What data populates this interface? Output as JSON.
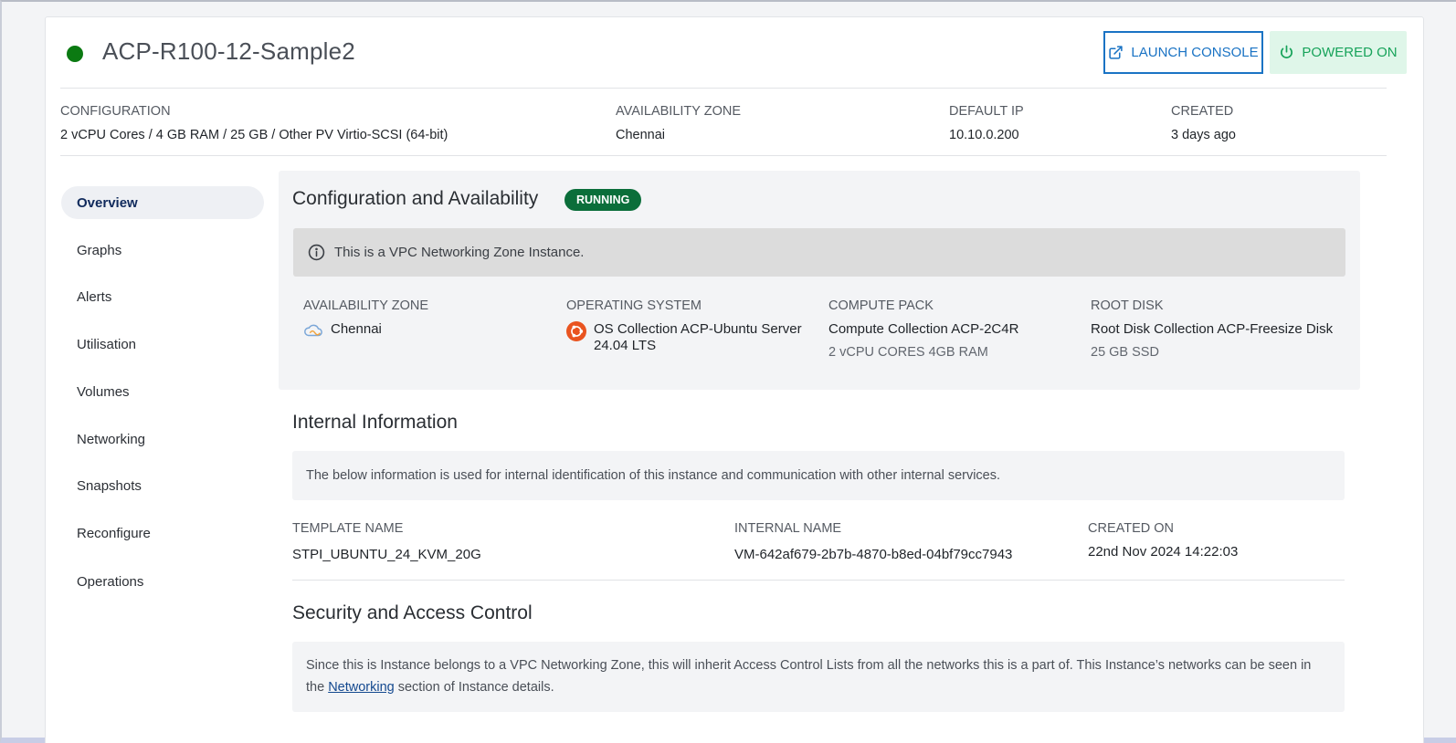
{
  "instance": {
    "name": "ACP-R100-12-Sample2",
    "status_color": "#0b7a12"
  },
  "actions": {
    "console_label": "LAUNCH CONSOLE",
    "console_icon": "external-link-icon",
    "power_label": "POWERED ON",
    "power_icon": "power-icon"
  },
  "summary": {
    "configuration_label": "CONFIGURATION",
    "configuration_value": "2 vCPU Cores / 4 GB RAM / 25 GB / Other PV Virtio-SCSI (64-bit)",
    "zone_label": "AVAILABILITY ZONE",
    "zone_value": "Chennai",
    "ip_label": "DEFAULT IP",
    "ip_value": "10.10.0.200",
    "created_label": "CREATED",
    "created_value": "3 days ago"
  },
  "sidebar": {
    "items": [
      {
        "label": "Overview",
        "active": true
      },
      {
        "label": "Graphs"
      },
      {
        "label": "Alerts"
      },
      {
        "label": "Utilisation"
      },
      {
        "label": "Volumes"
      },
      {
        "label": "Networking"
      },
      {
        "label": "Snapshots"
      },
      {
        "label": "Reconfigure"
      },
      {
        "label": "Operations"
      }
    ]
  },
  "config_section": {
    "title": "Configuration and Availability",
    "badge": "RUNNING",
    "badge_color": "#0b6e3a",
    "notice": "This is a VPC Networking Zone Instance.",
    "zone_label": "AVAILABILITY ZONE",
    "zone_value": "Chennai",
    "os_label": "OPERATING SYSTEM",
    "os_value_line1": "OS Collection ACP-Ubuntu Server",
    "os_value_line2": "24.04 LTS",
    "compute_label": "COMPUTE PACK",
    "compute_value": "Compute Collection ACP-2C4R",
    "compute_sub": "2 vCPU CORES 4GB RAM",
    "disk_label": "ROOT DISK",
    "disk_value": "Root Disk Collection ACP-Freesize Disk",
    "disk_sub": "25 GB SSD"
  },
  "internal_section": {
    "title": "Internal Information",
    "description": "The below information is used for internal identification of this instance and communication with other internal services.",
    "template_label": "TEMPLATE NAME",
    "template_value": "STPI_UBUNTU_24_KVM_20G",
    "internal_label": "INTERNAL NAME",
    "internal_value": "VM-642af679-2b7b-4870-b8ed-04bf79cc7943",
    "created_label": "CREATED ON",
    "created_value": "22nd Nov 2024 14:22:03"
  },
  "security_section": {
    "title": "Security and Access Control",
    "text_before": "Since this is Instance belongs to a VPC Networking Zone, this will inherit Access Control Lists from all the networks this is a part of. This Instance’s networks can be seen in the ",
    "link": "Networking",
    "text_after": " section of Instance details."
  }
}
